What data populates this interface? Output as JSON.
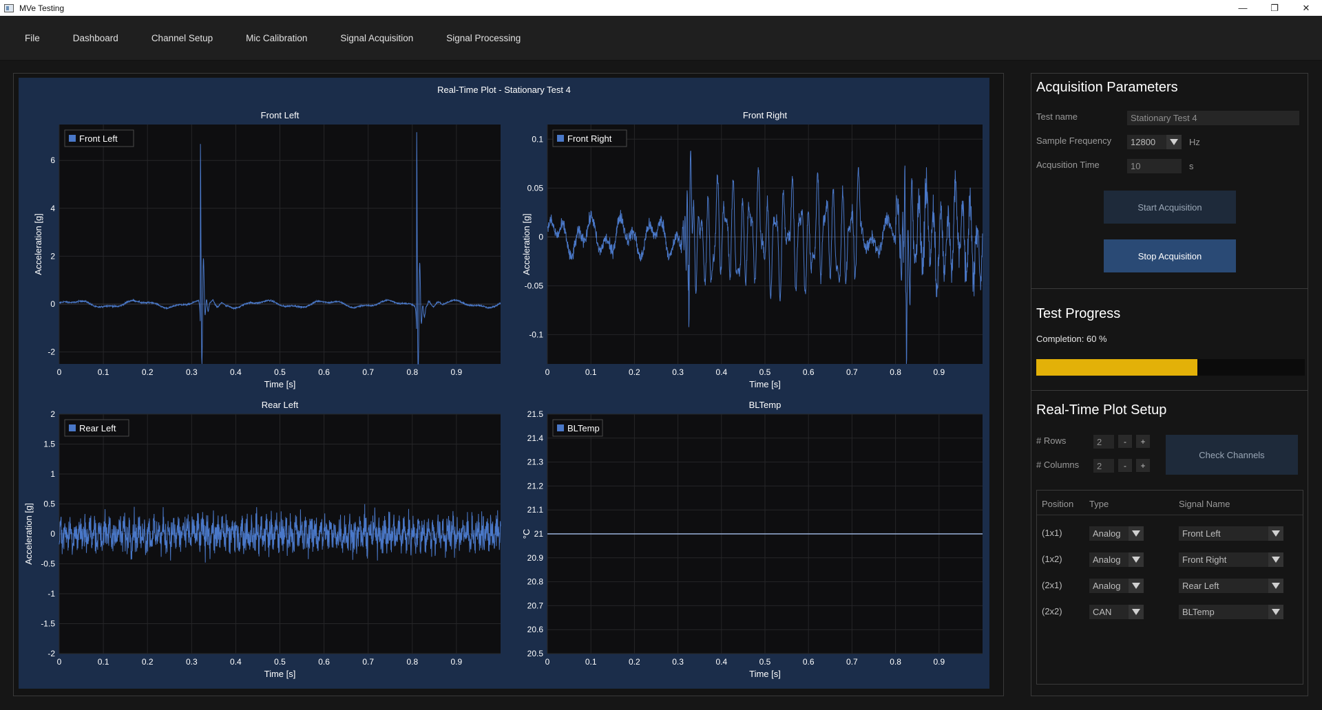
{
  "window": {
    "title": "MVe Testing",
    "controls": [
      "—",
      "❐",
      "✕"
    ]
  },
  "menu": [
    "File",
    "Dashboard",
    "Channel Setup",
    "Mic Calibration",
    "Signal Acquisition",
    "Signal Processing"
  ],
  "plot_panel": {
    "title": "Real-Time Plot - Stationary Test 4"
  },
  "chart_data": [
    {
      "type": "line",
      "title": "Front Left",
      "xlabel": "Time [s]",
      "ylabel": "Acceleration [g]",
      "legend": "Front Left",
      "xlim": [
        0,
        1
      ],
      "ylim": [
        -2.5,
        7.5
      ],
      "xticks": [
        "0",
        "0.1",
        "0.2",
        "0.3",
        "0.4",
        "0.5",
        "0.6",
        "0.7",
        "0.8",
        "0.9"
      ],
      "yticks": [
        "6",
        "4",
        "2",
        "0",
        "-2"
      ],
      "color": "#4a78c8"
    },
    {
      "type": "line",
      "title": "Front Right",
      "xlabel": "Time [s]",
      "ylabel": "Acceleration [g]",
      "legend": "Front Right",
      "xlim": [
        0,
        1
      ],
      "ylim": [
        -0.13,
        0.115
      ],
      "xticks": [
        "0",
        "0.1",
        "0.2",
        "0.3",
        "0.4",
        "0.5",
        "0.6",
        "0.7",
        "0.8",
        "0.9"
      ],
      "yticks": [
        "0.1",
        "0.05",
        "0",
        "-0.05",
        "-0.1"
      ],
      "color": "#4a78c8"
    },
    {
      "type": "line",
      "title": "Rear Left",
      "xlabel": "Time [s]",
      "ylabel": "Acceleration [g]",
      "legend": "Rear Left",
      "xlim": [
        0,
        1
      ],
      "ylim": [
        -2,
        2
      ],
      "xticks": [
        "0",
        "0.1",
        "0.2",
        "0.3",
        "0.4",
        "0.5",
        "0.6",
        "0.7",
        "0.8",
        "0.9"
      ],
      "yticks": [
        "2",
        "1.5",
        "1",
        "0.5",
        "0",
        "-0.5",
        "-1",
        "-1.5",
        "-2"
      ],
      "color": "#4a78c8"
    },
    {
      "type": "line",
      "title": "BLTemp",
      "xlabel": "Time [s]",
      "ylabel": "°C",
      "legend": "BLTemp",
      "xlim": [
        0,
        1
      ],
      "ylim": [
        20.5,
        21.5
      ],
      "xticks": [
        "0",
        "0.1",
        "0.2",
        "0.3",
        "0.4",
        "0.5",
        "0.6",
        "0.7",
        "0.8",
        "0.9"
      ],
      "yticks": [
        "21.5",
        "21.4",
        "21.3",
        "21.2",
        "21.1",
        "21",
        "20.9",
        "20.8",
        "20.7",
        "20.6",
        "20.5"
      ],
      "x": [
        0,
        1
      ],
      "y": [
        21,
        21
      ],
      "color": "#9bb4dc"
    }
  ],
  "acq": {
    "title": "Acquisition Parameters",
    "test_name_label": "Test name",
    "test_name_value": "Stationary Test 4",
    "freq_label": "Sample Frequency",
    "freq_value": "12800",
    "freq_unit": "Hz",
    "time_label": "Acqusition Time",
    "time_value": "10",
    "time_unit": "s",
    "start_label": "Start Acquisition",
    "stop_label": "Stop Acquisition"
  },
  "progress": {
    "title": "Test Progress",
    "completion_text": "Completion: 60 %",
    "value": 0.6,
    "color": "#e3b108"
  },
  "rtsetup": {
    "title": "Real-Time Plot Setup",
    "rows_label": "# Rows",
    "rows_value": "2",
    "cols_label": "# Columns",
    "cols_value": "2",
    "minus": "-",
    "plus": "+",
    "check_label": "Check Channels",
    "headers": [
      "Position",
      "Type",
      "Signal Name"
    ],
    "rows": [
      {
        "position": "(1x1)",
        "type": "Analog",
        "signal": "Front Left"
      },
      {
        "position": "(1x2)",
        "type": "Analog",
        "signal": "Front Right"
      },
      {
        "position": "(2x1)",
        "type": "Analog",
        "signal": "Rear Left"
      },
      {
        "position": "(2x2)",
        "type": "CAN",
        "signal": "BLTemp"
      }
    ]
  }
}
